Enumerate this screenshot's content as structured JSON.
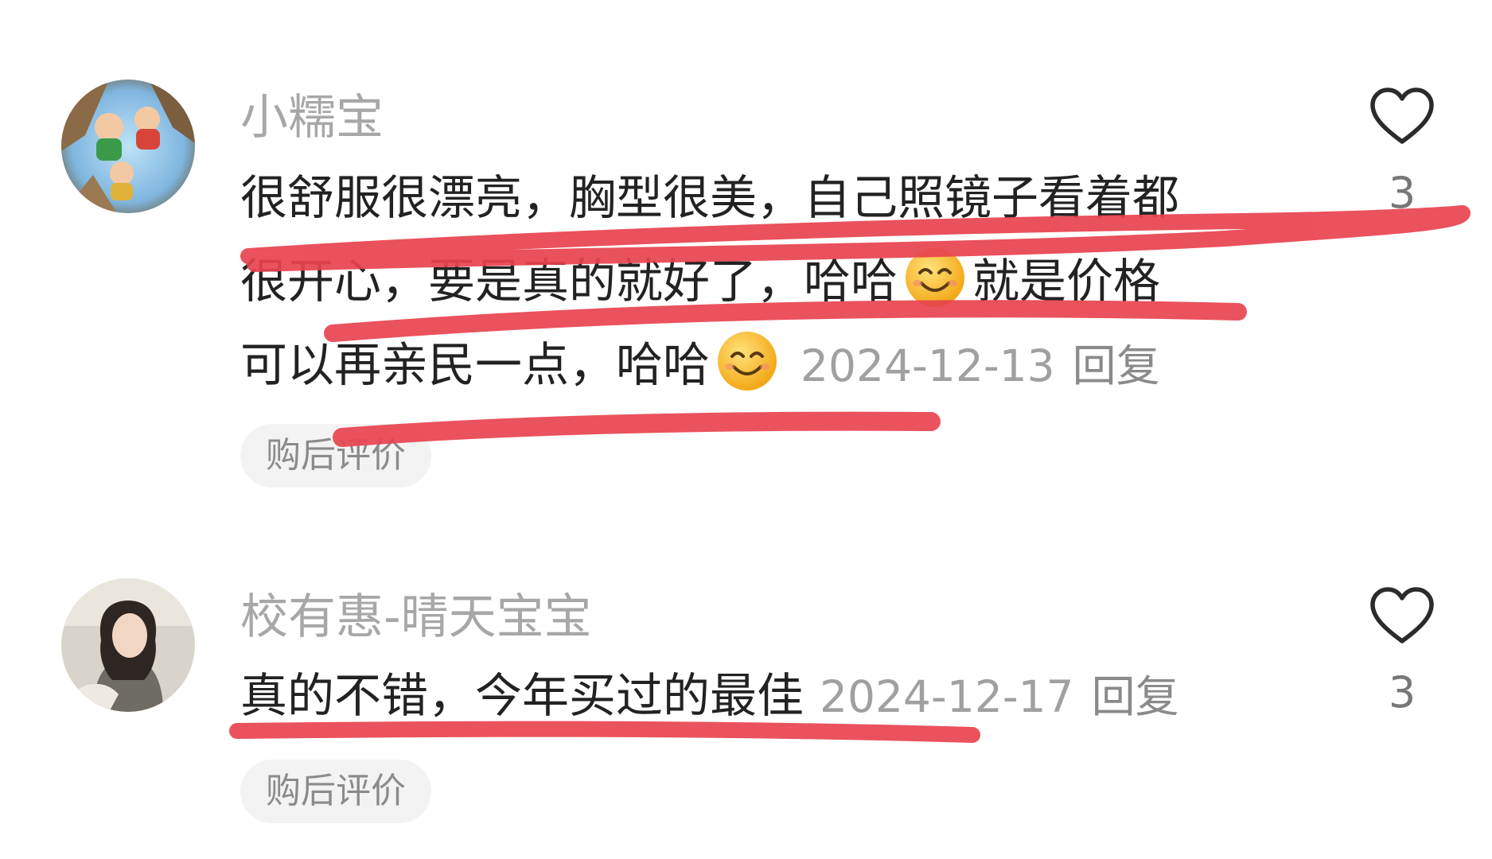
{
  "comments": [
    {
      "username": "小糯宝",
      "lines": [
        "很舒服很漂亮，胸型很美，自己照镜子看着都",
        "很开心，要是真的就好了，哈哈",
        "就是价格",
        "可以再亲民一点，哈哈"
      ],
      "date": "2024-12-13",
      "reply_label": "回复",
      "tag": "购后评价",
      "like_count": "3"
    },
    {
      "username": "校有惠-晴天宝宝",
      "lines": [
        "真的不错，今年买过的最佳"
      ],
      "date": "2024-12-17",
      "reply_label": "回复",
      "tag": "购后评价",
      "like_count": "3"
    }
  ],
  "icons": {
    "like": "heart-outline-icon",
    "emoji": "smiling-face-emoji"
  },
  "colors": {
    "annotation": "#e8434f",
    "username": "#a7a7a7",
    "body": "#222222"
  }
}
